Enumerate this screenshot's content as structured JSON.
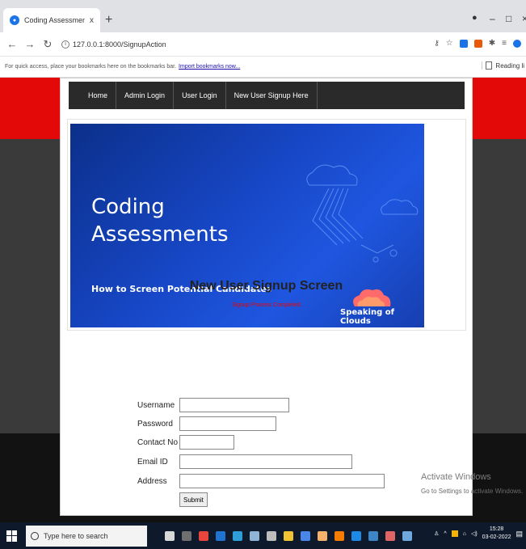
{
  "browser": {
    "tab_title": "Coding Assessment Portal",
    "tab_close": "x",
    "new_tab": "+",
    "url": "127.0.0.1:8000/SignupAction",
    "bookmarks_prompt": "For quick access, place your bookmarks here on the bookmarks bar.",
    "import_bookmarks": "Import bookmarks now...",
    "reading_list": "Reading li"
  },
  "nav": {
    "items": [
      {
        "label": "Home"
      },
      {
        "label": "Admin Login"
      },
      {
        "label": "User Login"
      },
      {
        "label": "New User Signup Here"
      }
    ]
  },
  "banner": {
    "title_line1": "Coding",
    "title_line2": "Assessments",
    "subtitle": "How to Screen Potential Candidates",
    "brand": "Speaking of Clouds"
  },
  "signup": {
    "title": "New User Signup Screen",
    "status": "Signup Process Completed",
    "fields": {
      "username": {
        "label": "Username",
        "value": ""
      },
      "password": {
        "label": "Password",
        "value": ""
      },
      "contact": {
        "label": "Contact No",
        "value": ""
      },
      "email": {
        "label": "Email ID",
        "value": ""
      },
      "address": {
        "label": "Address",
        "value": ""
      }
    },
    "submit_label": "Submit"
  },
  "watermark": {
    "line1": "Activate Windows",
    "line2": "Go to Settings to activate Windows."
  },
  "taskbar": {
    "search_placeholder": "Type here to search",
    "time": "15:28",
    "date": "03-02-2022"
  },
  "colors": {
    "red_band": "#e30909",
    "dark_band": "#3a3a3a",
    "navbar": "#2a2a2a",
    "status_red": "#ee0000"
  }
}
